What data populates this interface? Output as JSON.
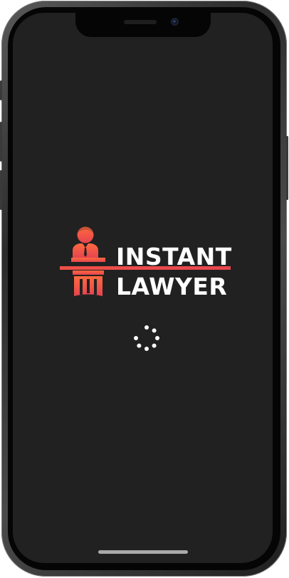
{
  "app": {
    "logo_line1": "INSTANT",
    "logo_line2": "LAWYER"
  },
  "colors": {
    "screen_background": "#212121",
    "brand_gradient_top": "#ff5f3f",
    "brand_gradient_bottom": "#e8454f",
    "logo_text": "#ffffff",
    "spinner": "#ffffff"
  },
  "icons": {
    "logo_emblem": "lawyer-at-podium-icon",
    "loading": "loading-spinner-icon"
  }
}
